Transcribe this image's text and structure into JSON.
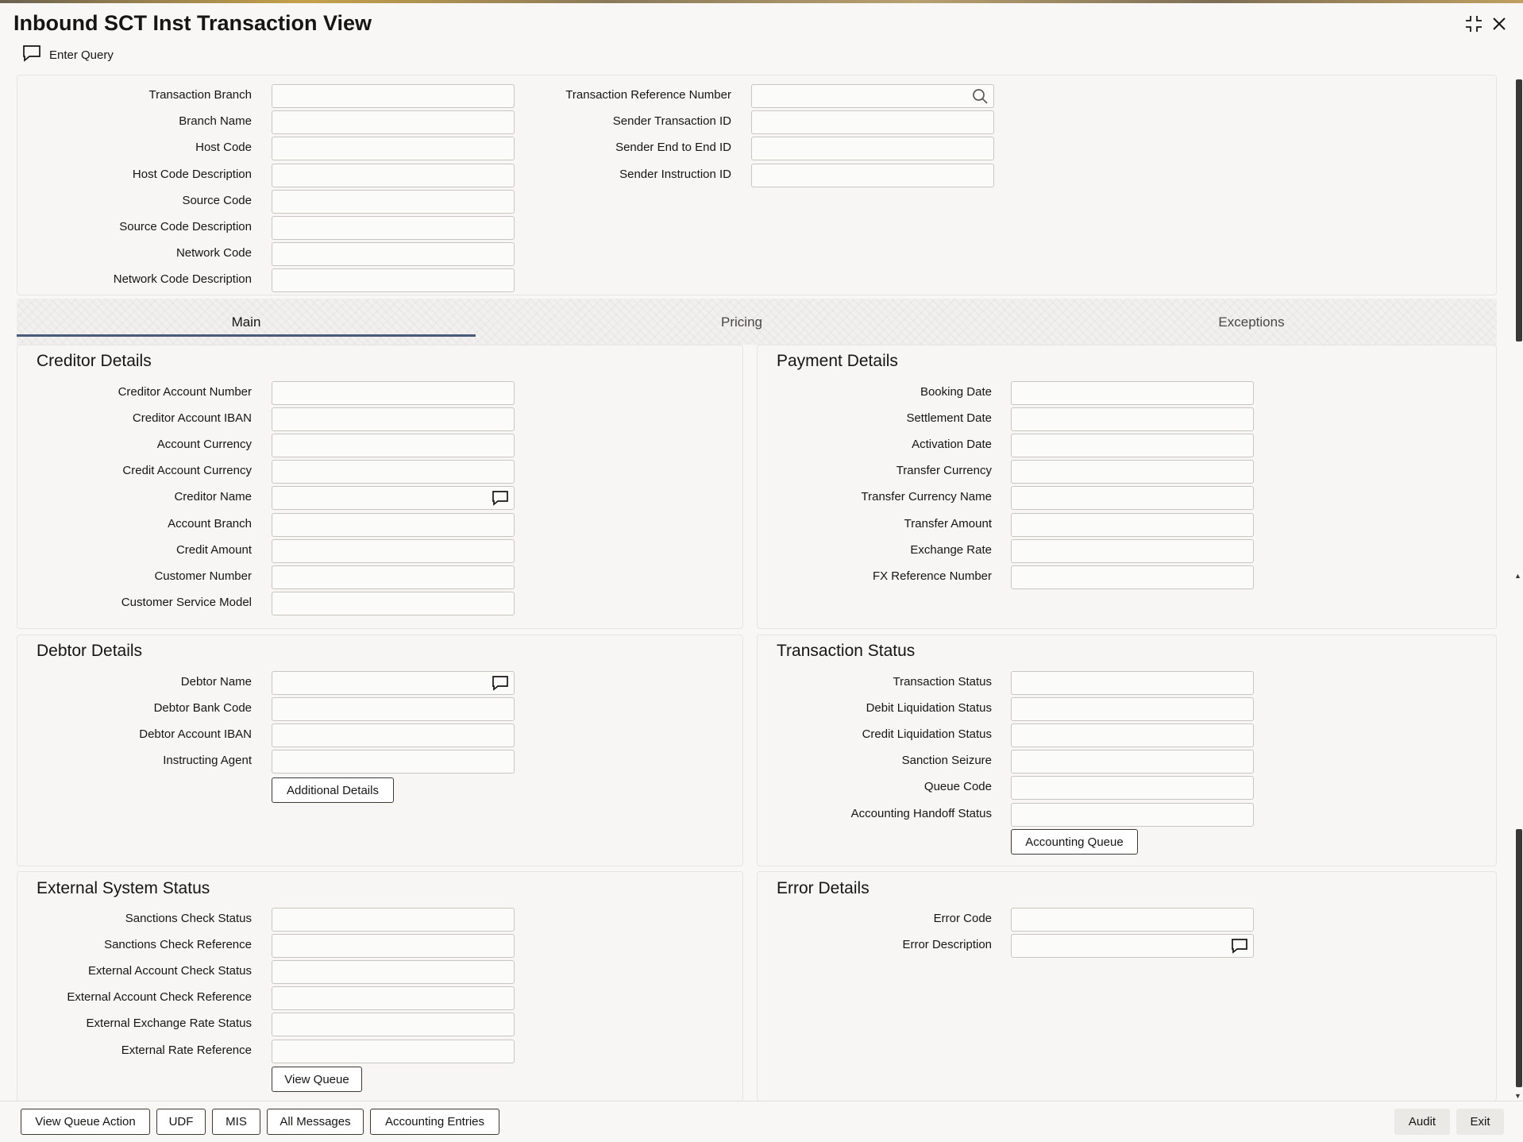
{
  "window": {
    "title": "Inbound SCT Inst Transaction View"
  },
  "toolbar": {
    "enter_query": "Enter Query"
  },
  "header_fields": {
    "left": [
      {
        "label": "Transaction Branch",
        "value": ""
      },
      {
        "label": "Branch Name",
        "value": ""
      },
      {
        "label": "Host Code",
        "value": ""
      },
      {
        "label": "Host Code Description",
        "value": ""
      },
      {
        "label": "Source Code",
        "value": ""
      },
      {
        "label": "Source Code Description",
        "value": ""
      },
      {
        "label": "Network Code",
        "value": ""
      },
      {
        "label": "Network Code Description",
        "value": ""
      }
    ],
    "right": [
      {
        "label": "Transaction Reference Number",
        "value": ""
      },
      {
        "label": "Sender Transaction ID",
        "value": ""
      },
      {
        "label": "Sender End to End ID",
        "value": ""
      },
      {
        "label": "Sender Instruction ID",
        "value": ""
      }
    ]
  },
  "tabs": [
    {
      "label": "Main",
      "active": true
    },
    {
      "label": "Pricing",
      "active": false
    },
    {
      "label": "Exceptions",
      "active": false
    }
  ],
  "creditor": {
    "title": "Creditor Details",
    "fields": [
      {
        "label": "Creditor Account Number",
        "value": ""
      },
      {
        "label": "Creditor Account IBAN",
        "value": ""
      },
      {
        "label": "Account Currency",
        "value": ""
      },
      {
        "label": "Credit Account Currency",
        "value": ""
      },
      {
        "label": "Creditor Name",
        "value": ""
      },
      {
        "label": "Account Branch",
        "value": ""
      },
      {
        "label": "Credit Amount",
        "value": ""
      },
      {
        "label": "Customer Number",
        "value": ""
      },
      {
        "label": "Customer Service Model",
        "value": ""
      }
    ]
  },
  "payment": {
    "title": "Payment Details",
    "fields": [
      {
        "label": "Booking Date",
        "value": ""
      },
      {
        "label": "Settlement Date",
        "value": ""
      },
      {
        "label": "Activation Date",
        "value": ""
      },
      {
        "label": "Transfer Currency",
        "value": ""
      },
      {
        "label": "Transfer Currency Name",
        "value": ""
      },
      {
        "label": "Transfer Amount",
        "value": ""
      },
      {
        "label": "Exchange Rate",
        "value": ""
      },
      {
        "label": "FX Reference Number",
        "value": ""
      }
    ]
  },
  "debtor": {
    "title": "Debtor Details",
    "fields": [
      {
        "label": "Debtor Name",
        "value": ""
      },
      {
        "label": "Debtor Bank Code",
        "value": ""
      },
      {
        "label": "Debtor Account IBAN",
        "value": ""
      },
      {
        "label": "Instructing Agent",
        "value": ""
      }
    ],
    "button": "Additional Details"
  },
  "status": {
    "title": "Transaction Status",
    "fields": [
      {
        "label": "Transaction Status",
        "value": ""
      },
      {
        "label": "Debit Liquidation Status",
        "value": ""
      },
      {
        "label": "Credit Liquidation Status",
        "value": ""
      },
      {
        "label": "Sanction Seizure",
        "value": ""
      },
      {
        "label": "Queue Code",
        "value": ""
      },
      {
        "label": "Accounting Handoff Status",
        "value": ""
      }
    ],
    "button": "Accounting Queue"
  },
  "external": {
    "title": "External System Status",
    "fields": [
      {
        "label": "Sanctions Check Status",
        "value": ""
      },
      {
        "label": "Sanctions Check Reference",
        "value": ""
      },
      {
        "label": "External Account Check Status",
        "value": ""
      },
      {
        "label": "External Account Check Reference",
        "value": ""
      },
      {
        "label": "External Exchange Rate Status",
        "value": ""
      },
      {
        "label": "External Rate Reference",
        "value": ""
      }
    ],
    "button": "View Queue"
  },
  "error": {
    "title": "Error Details",
    "fields": [
      {
        "label": "Error Code",
        "value": ""
      },
      {
        "label": "Error Description",
        "value": ""
      }
    ]
  },
  "footer": {
    "left_buttons": [
      "View Queue Action",
      "UDF",
      "MIS",
      "All Messages",
      "Accounting Entries"
    ],
    "right_buttons": [
      "Audit",
      "Exit"
    ]
  },
  "icons": {
    "maximize": "maximize-icon",
    "close": "close-icon",
    "enter_query": "comment-icon",
    "lookup": "search-icon",
    "text_expand": "comment-icon"
  },
  "colors": {
    "tab_underline": "#4b5a78",
    "button_border": "#3d3a36",
    "field_border": "#c9c6c1"
  }
}
